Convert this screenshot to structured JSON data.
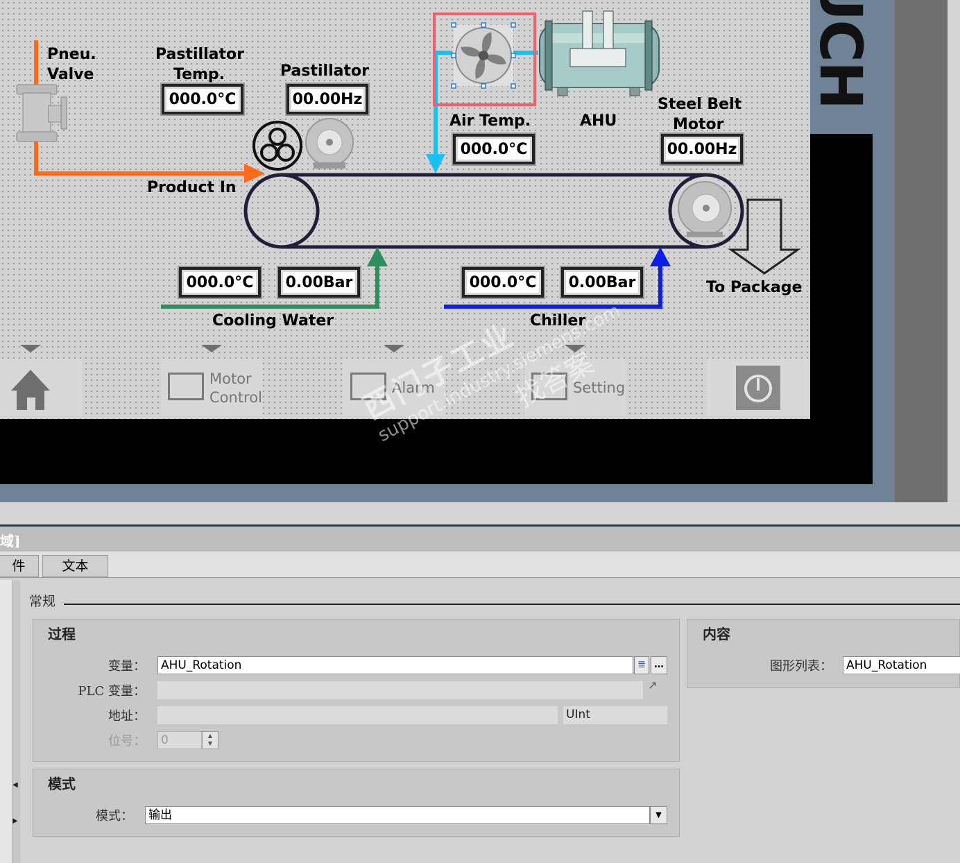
{
  "hmi": {
    "labels": {
      "pneu_valve_1": "Pneu.",
      "pneu_valve_2": "Valve",
      "past_temp_1": "Pastillator",
      "past_temp_2": "Temp.",
      "past_freq": "Pastillator",
      "air_temp": "Air Temp.",
      "ahu": "AHU",
      "steel_belt_1": "Steel Belt",
      "steel_belt_2": "Motor",
      "product_in": "Product In",
      "to_package": "To Package",
      "cooling_water": "Cooling Water",
      "chiller": "Chiller"
    },
    "io_fields": {
      "past_temp": "000.0°C",
      "past_freq": "00.00Hz",
      "air_temp": "000.0°C",
      "belt_freq": "00.00Hz",
      "cooling_temp": "000.0°C",
      "cooling_press": "0.00Bar",
      "chiller_temp": "000.0°C",
      "chiller_press": "0.00Bar"
    },
    "nav": {
      "motor_1": "Motor",
      "motor_2": "Control",
      "alarm": "Alarm",
      "setting": "Setting"
    },
    "side_text": "UCH"
  },
  "watermark": {
    "line1": "西门子工业",
    "line2": "support.industry.siemens.com",
    "line3": "找答案"
  },
  "props": {
    "title": "域]",
    "tabs": [
      "件",
      "文本"
    ],
    "section": "常规",
    "process": {
      "title": "过程",
      "variable_label": "变量：",
      "variable_value": "AHU_Rotation",
      "plc_label": "PLC 变量：",
      "address_label": "地址：",
      "address_type": "UInt",
      "bit_label": "位号：",
      "bit_value": "0"
    },
    "mode": {
      "title": "模式",
      "label": "模式：",
      "value": "输出"
    },
    "content": {
      "title": "内容",
      "graphic_list_label": "图形列表：",
      "graphic_list_value": "AHU_Rotation"
    }
  }
}
